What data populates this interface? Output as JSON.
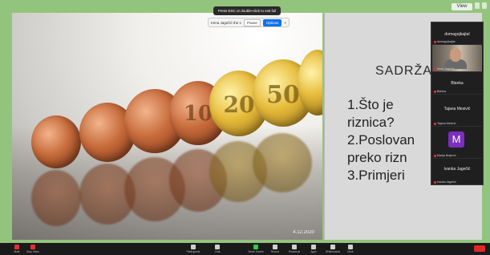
{
  "top": {
    "view_label": "View"
  },
  "share": {
    "banner": "Press ESC or double-click to exit full screen mode",
    "bar_text": "Irena Jagečić the sharing",
    "pause_label": "Pause",
    "share_label": "Options"
  },
  "photo": {
    "date": "4.12.2020",
    "coins": [
      "",
      "",
      "",
      "10",
      "20",
      "50",
      ""
    ]
  },
  "slide": {
    "title": "SADRŽA",
    "items": [
      "1.Što je",
      "riznica?",
      "2.Poslovan",
      "preko rizn",
      "3.Primjeri"
    ]
  },
  "participants": [
    {
      "name": "domagojbajtal",
      "label": "domagojbajtal",
      "type": "name"
    },
    {
      "name": "",
      "label": "Irena Jagečić",
      "type": "video"
    },
    {
      "name": "Blanka",
      "label": "Blanka",
      "type": "name"
    },
    {
      "name": "Tajana Mesivić",
      "label": "Tajana Mesivić",
      "type": "name"
    },
    {
      "name": "M",
      "label": "Marija Brajević",
      "type": "avatar"
    },
    {
      "name": "Ivanka Jagečić",
      "label": "Ivanka Jagečić",
      "type": "name"
    }
  ],
  "toolbar": {
    "left": [
      "Mute",
      "Stop Video"
    ],
    "center": [
      "Participants",
      "Chat",
      "Share Screen",
      "Record",
      "Reactions",
      "Apps",
      "Whiteboards",
      "More"
    ],
    "end_label": "End"
  },
  "colors": {
    "frame": "#93c47d",
    "panel": "#1f1f1f",
    "avatar": "#7b2fbf",
    "end": "#e02828"
  }
}
